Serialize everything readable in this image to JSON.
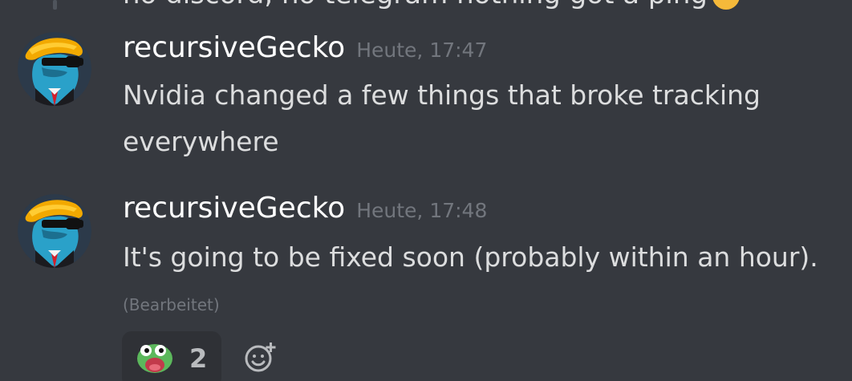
{
  "previous_message": {
    "text": "no discord, no telegram nothing got a ping"
  },
  "messages": [
    {
      "author": "recursiveGecko",
      "timestamp": "Heute, 17:47",
      "content": "Nvidia changed a few things that broke tracking everywhere"
    },
    {
      "author": "recursiveGecko",
      "timestamp": "Heute, 17:48",
      "content": "It's going to be fixed soon (probably within an hour).",
      "edited_label": "(Bearbeitet)",
      "reactions": [
        {
          "emoji": "poggers-frog-icon",
          "count": "2"
        }
      ]
    }
  ],
  "colors": {
    "background": "#36393f",
    "username": "#ffffff",
    "timestamp": "#72767d",
    "text": "#dcddde",
    "reaction_bg": "#2f3136"
  }
}
